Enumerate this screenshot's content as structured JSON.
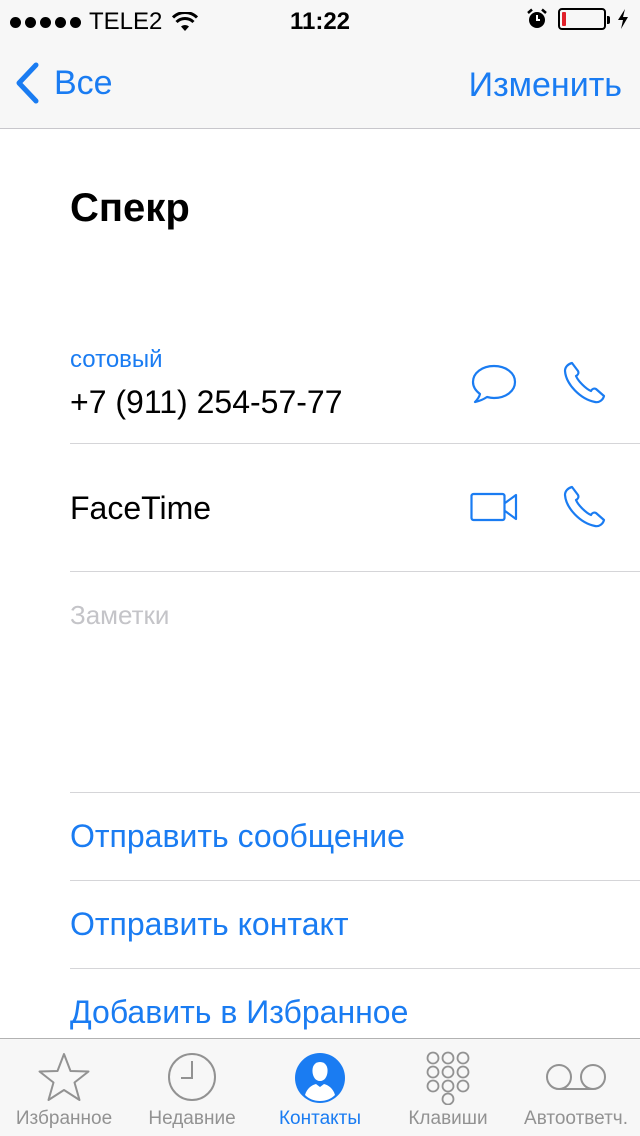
{
  "status_bar": {
    "carrier": "TELE2",
    "time": "11:22",
    "battery_level": 0.1
  },
  "nav": {
    "back_label": "Все",
    "edit_label": "Изменить"
  },
  "contact": {
    "name": "Спекр",
    "phone_type": "сотовый",
    "phone_number": "+7 (911) 254-57-77",
    "facetime_label": "FaceTime",
    "notes_placeholder": "Заметки"
  },
  "actions": [
    {
      "label": "Отправить сообщение"
    },
    {
      "label": "Отправить контакт"
    },
    {
      "label": "Добавить в Избранное"
    }
  ],
  "tabs": [
    {
      "label": "Избранное",
      "icon": "star-icon",
      "active": false
    },
    {
      "label": "Недавние",
      "icon": "clock-icon",
      "active": false
    },
    {
      "label": "Контакты",
      "icon": "contacts-icon",
      "active": true
    },
    {
      "label": "Клавиши",
      "icon": "keypad-icon",
      "active": false
    },
    {
      "label": "Автоответч.",
      "icon": "voicemail-icon",
      "active": false
    }
  ],
  "colors": {
    "accent": "#1a7cf2",
    "inactive": "#929292",
    "battery_low": "#e0202a"
  }
}
